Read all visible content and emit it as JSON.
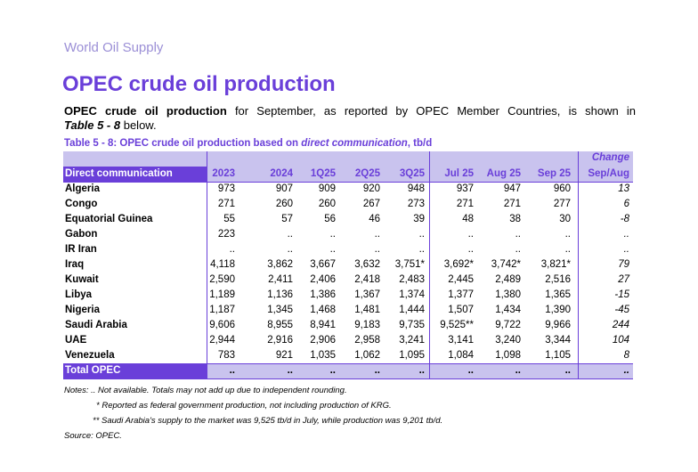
{
  "section_label": "World Oil Supply",
  "title": "OPEC crude oil production",
  "intro": {
    "bold_lead": "OPEC crude oil production",
    "text_mid": " for September, as reported by OPEC Member Countries, is shown in ",
    "ref": "Table 5 - 8",
    "text_end": " below."
  },
  "table_caption": {
    "lead": "Table 5 - 8: OPEC crude oil production based on ",
    "italic": "direct communication",
    "tail": ", tb/d"
  },
  "table": {
    "change_label": "Change",
    "columns": [
      "Direct communication",
      "2023",
      "2024",
      "1Q25",
      "2Q25",
      "3Q25",
      "Jul 25",
      "Aug 25",
      "Sep 25",
      "Sep/Aug"
    ],
    "rows": [
      [
        "Algeria",
        "973",
        "907",
        "909",
        "920",
        "948",
        "937",
        "947",
        "960",
        "13"
      ],
      [
        "Congo",
        "271",
        "260",
        "260",
        "267",
        "273",
        "271",
        "271",
        "277",
        "6"
      ],
      [
        "Equatorial Guinea",
        "55",
        "57",
        "56",
        "46",
        "39",
        "48",
        "38",
        "30",
        "-8"
      ],
      [
        "Gabon",
        "223",
        "..",
        "..",
        "..",
        "..",
        "..",
        "..",
        "..",
        ".."
      ],
      [
        "IR Iran",
        "..",
        "..",
        "..",
        "..",
        "..",
        "..",
        "..",
        "..",
        ".."
      ],
      [
        "Iraq",
        "4,118",
        "3,862",
        "3,667",
        "3,632",
        "3,751*",
        "3,692*",
        "3,742*",
        "3,821*",
        "79"
      ],
      [
        "Kuwait",
        "2,590",
        "2,411",
        "2,406",
        "2,418",
        "2,483",
        "2,445",
        "2,489",
        "2,516",
        "27"
      ],
      [
        "Libya",
        "1,189",
        "1,136",
        "1,386",
        "1,367",
        "1,374",
        "1,377",
        "1,380",
        "1,365",
        "-15"
      ],
      [
        "Nigeria",
        "1,187",
        "1,345",
        "1,468",
        "1,481",
        "1,444",
        "1,507",
        "1,434",
        "1,390",
        "-45"
      ],
      [
        "Saudi Arabia",
        "9,606",
        "8,955",
        "8,941",
        "9,183",
        "9,735",
        "9,525**",
        "9,722",
        "9,966",
        "244"
      ],
      [
        "UAE",
        "2,944",
        "2,916",
        "2,906",
        "2,958",
        "3,241",
        "3,141",
        "3,240",
        "3,344",
        "104"
      ],
      [
        "Venezuela",
        "783",
        "921",
        "1,035",
        "1,062",
        "1,095",
        "1,084",
        "1,098",
        "1,105",
        "8"
      ]
    ],
    "total": [
      "Total  OPEC",
      "..",
      "..",
      "..",
      "..",
      "..",
      "..",
      "..",
      "..",
      ".."
    ]
  },
  "notes": [
    "Notes: .. Not available. Totals may not add up due to independent rounding.",
    "* Reported as federal government production, not including production of KRG.",
    "** Saudi Arabia's supply to the market was 9,525 tb/d in July, while production was 9,201 tb/d.",
    "Source: OPEC."
  ]
}
